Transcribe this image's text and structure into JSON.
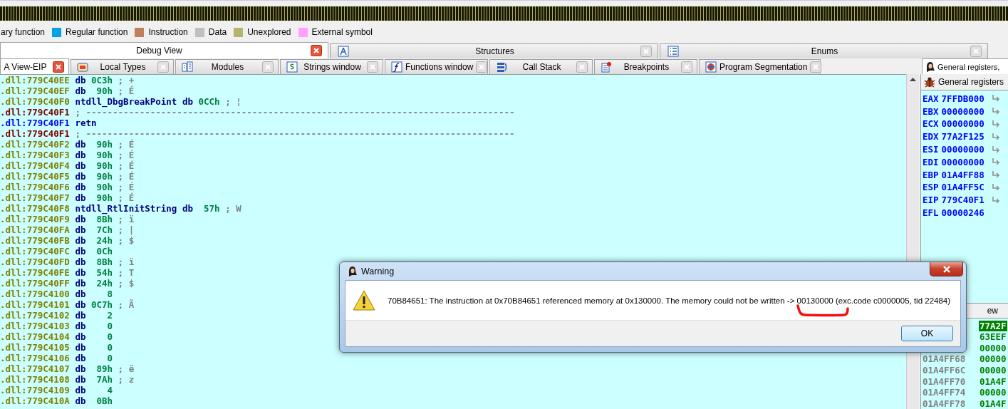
{
  "legend": [
    {
      "label": "ary function"
    },
    {
      "label": "Regular function",
      "color": "#00a2e8"
    },
    {
      "label": "Instruction",
      "color": "#c0805c"
    },
    {
      "label": "Data",
      "color": "#c0c0c0"
    },
    {
      "label": "Unexplored",
      "color": "#b4b46c"
    },
    {
      "label": "External symbol",
      "color": "#ffa0ff"
    }
  ],
  "upper_tabs": [
    {
      "label": "Debug View",
      "selected": true
    },
    {
      "label": "Structures",
      "selected": false
    },
    {
      "label": "Enums",
      "selected": false
    }
  ],
  "lower_tabs": [
    {
      "label": "A View-EIP",
      "selected": true
    },
    {
      "label": "Local Types",
      "selected": false
    },
    {
      "label": "Modules",
      "selected": false
    },
    {
      "label": "Strings window",
      "selected": false
    },
    {
      "label": "Functions window",
      "selected": false
    },
    {
      "label": "Call Stack",
      "selected": false
    },
    {
      "label": "Breakpoints",
      "selected": false
    },
    {
      "label": "Program Segmentation",
      "selected": false
    }
  ],
  "listing": [
    {
      "address": ".dll:779C40EE",
      "kind": "data",
      "mnemonic": "db",
      "operand": "0C3h",
      "comment": "; +"
    },
    {
      "address": ".dll:779C40EF",
      "kind": "data",
      "mnemonic": "db",
      "operand": "90h",
      "comment": "; É"
    },
    {
      "address": ".dll:779C40F0",
      "kind": "data",
      "label": "ntdll_DbgBreakPoint",
      "mnemonic": "db",
      "operand": "0CCh",
      "comment": "; ¦"
    },
    {
      "address": ".dll:779C40F1",
      "kind": "separator",
      "comment": "; --------------------------------------------------------------------------------"
    },
    {
      "address": ".dll:779C40F1",
      "kind": "code",
      "mnemonic": "retn"
    },
    {
      "address": ".dll:779C40F1",
      "kind": "separator",
      "comment": "; --------------------------------------------------------------------------------"
    },
    {
      "address": ".dll:779C40F2",
      "kind": "data",
      "mnemonic": "db",
      "operand": "90h",
      "comment": "; É"
    },
    {
      "address": ".dll:779C40F3",
      "kind": "data",
      "mnemonic": "db",
      "operand": "90h",
      "comment": "; É"
    },
    {
      "address": ".dll:779C40F4",
      "kind": "data",
      "mnemonic": "db",
      "operand": "90h",
      "comment": "; É"
    },
    {
      "address": ".dll:779C40F5",
      "kind": "data",
      "mnemonic": "db",
      "operand": "90h",
      "comment": "; É"
    },
    {
      "address": ".dll:779C40F6",
      "kind": "data",
      "mnemonic": "db",
      "operand": "90h",
      "comment": "; É"
    },
    {
      "address": ".dll:779C40F7",
      "kind": "data",
      "mnemonic": "db",
      "operand": "90h",
      "comment": "; É"
    },
    {
      "address": ".dll:779C40F8",
      "kind": "data",
      "label": "ntdll_RtlInitString",
      "mnemonic": "db",
      "operand": "57h",
      "comment": "; W"
    },
    {
      "address": ".dll:779C40F9",
      "kind": "data",
      "mnemonic": "db",
      "operand": "8Bh",
      "comment": "; ï"
    },
    {
      "address": ".dll:779C40FA",
      "kind": "data",
      "mnemonic": "db",
      "operand": "7Ch",
      "comment": "; |"
    },
    {
      "address": ".dll:779C40FB",
      "kind": "data",
      "mnemonic": "db",
      "operand": "24h",
      "comment": "; $"
    },
    {
      "address": ".dll:779C40FC",
      "kind": "data",
      "mnemonic": "db",
      "operand": "0Ch"
    },
    {
      "address": ".dll:779C40FD",
      "kind": "data",
      "mnemonic": "db",
      "operand": "8Bh",
      "comment": "; ï"
    },
    {
      "address": ".dll:779C40FE",
      "kind": "data",
      "mnemonic": "db",
      "operand": "54h",
      "comment": "; T"
    },
    {
      "address": ".dll:779C40FF",
      "kind": "data",
      "mnemonic": "db",
      "operand": "24h",
      "comment": "; $"
    },
    {
      "address": ".dll:779C4100",
      "kind": "data",
      "mnemonic": "db",
      "operand": "8"
    },
    {
      "address": ".dll:779C4101",
      "kind": "data",
      "mnemonic": "db",
      "operand": "0C7h",
      "comment": "; Ã"
    },
    {
      "address": ".dll:779C4102",
      "kind": "data",
      "mnemonic": "db",
      "operand": "2"
    },
    {
      "address": ".dll:779C4103",
      "kind": "data",
      "mnemonic": "db",
      "operand": "0"
    },
    {
      "address": ".dll:779C4104",
      "kind": "data",
      "mnemonic": "db",
      "operand": "0"
    },
    {
      "address": ".dll:779C4105",
      "kind": "data",
      "mnemonic": "db",
      "operand": "0"
    },
    {
      "address": ".dll:779C4106",
      "kind": "data",
      "mnemonic": "db",
      "operand": "0"
    },
    {
      "address": ".dll:779C4107",
      "kind": "data",
      "mnemonic": "db",
      "operand": "89h",
      "comment": "; ë"
    },
    {
      "address": ".dll:779C4108",
      "kind": "data",
      "mnemonic": "db",
      "operand": "7Ah",
      "comment": "; z"
    },
    {
      "address": ".dll:779C4109",
      "kind": "data",
      "mnemonic": "db",
      "operand": "4"
    },
    {
      "address": ".dll:779C410A",
      "kind": "data",
      "mnemonic": "db",
      "operand": "0Bh"
    }
  ],
  "right_pane": {
    "tab": "General registers,",
    "header": "General registers",
    "registers": [
      {
        "name": "EAX",
        "value": "7FFDB000",
        "arrow": true
      },
      {
        "name": "EBX",
        "value": "00000000",
        "arrow": true
      },
      {
        "name": "ECX",
        "value": "00000000",
        "arrow": true
      },
      {
        "name": "EDX",
        "value": "77A2F125",
        "arrow": true
      },
      {
        "name": "ESI",
        "value": "00000000",
        "arrow": true
      },
      {
        "name": "EDI",
        "value": "00000000",
        "arrow": true
      },
      {
        "name": "EBP",
        "value": "01A4FF88",
        "arrow": true
      },
      {
        "name": "ESP",
        "value": "01A4FF5C",
        "arrow": true
      },
      {
        "name": "EIP",
        "value": "779C40F1",
        "arrow": true
      },
      {
        "name": "EFL",
        "value": "00000246",
        "arrow": false
      }
    ],
    "stack_header": "ew",
    "stack": [
      {
        "value": "77A2F",
        "selected": true
      },
      {
        "value": "63EEF",
        "selected": false
      },
      {
        "value": "00000",
        "selected": false
      },
      {
        "address": "01A4FF68",
        "value": "00000",
        "selected": false
      },
      {
        "address": "01A4FF6C",
        "value": "00000",
        "selected": false
      },
      {
        "address": "01A4FF70",
        "value": "01A4F",
        "selected": false
      },
      {
        "address": "01A4FF74",
        "value": "00000",
        "selected": false
      },
      {
        "address": "01A4FF78",
        "value": "01A4F",
        "selected": false
      }
    ]
  },
  "dialog": {
    "title": "Warning",
    "message": "70B84651: The instruction at 0x70B84651 referenced memory at 0x130000. The memory could not be written -> 00130000 (exc.code c0000005, tid 22484)",
    "buttons": [
      "OK"
    ]
  }
}
